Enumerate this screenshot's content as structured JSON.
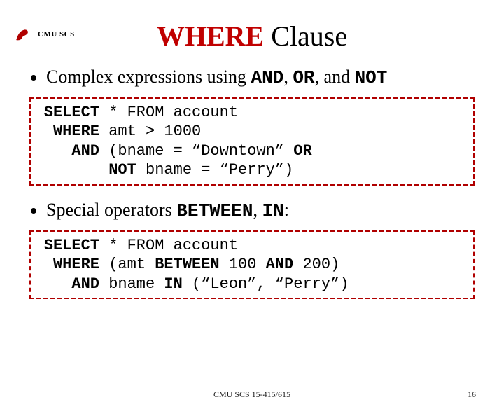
{
  "header": {
    "org": "CMU SCS"
  },
  "title": {
    "where": "WHERE",
    "clause": " Clause"
  },
  "bullets": {
    "b1_pre": "Complex expressions using ",
    "b1_and": "AND",
    "b1_sep1": ", ",
    "b1_or": "OR",
    "b1_sep2": ", and ",
    "b1_not": "NOT",
    "b2_pre": "Special operators ",
    "b2_between": "BETWEEN",
    "b2_sep": ", ",
    "b2_in": "IN",
    "b2_colon": ":"
  },
  "code1": {
    "l1k": "SELECT",
    "l1r": " * FROM account",
    "l2k": "WHERE",
    "l2r": " amt > 1000",
    "l3k": "AND",
    "l3r_a": " (bname = “Downtown” ",
    "l3r_or": "OR",
    "l4k": "",
    "l4r_a": " ",
    "l4r_not": "NOT",
    "l4r_b": " bname = “Perry”)"
  },
  "code2": {
    "l1k": "SELECT",
    "l1r": " * FROM account",
    "l2k": "WHERE",
    "l2r_a": " (amt ",
    "l2r_between": "BETWEEN",
    "l2r_b": " 100 ",
    "l2r_and": "AND",
    "l2r_c": " 200)",
    "l3k": "AND",
    "l3r_a": " bname ",
    "l3r_in": "IN",
    "l3r_b": " (“Leon”, “Perry”)"
  },
  "footer": {
    "center": "CMU SCS 15-415/615",
    "page": "16"
  }
}
